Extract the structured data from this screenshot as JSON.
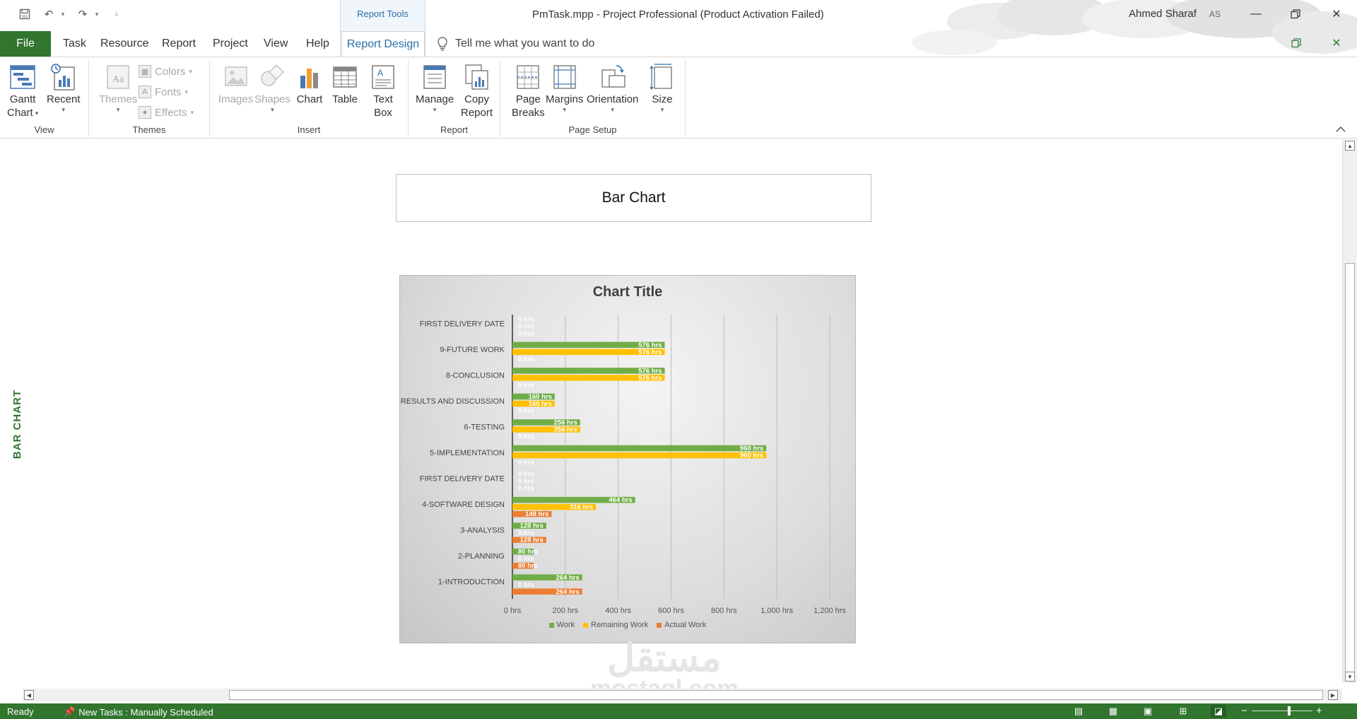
{
  "titlebar": {
    "context_tab_group": "Report Tools",
    "document_title": "PmTask.mpp  -  Project Professional (Product Activation Failed)",
    "user_name": "Ahmed Sharaf",
    "user_initials": "AS"
  },
  "tabs": {
    "file": "File",
    "task": "Task",
    "resource": "Resource",
    "report": "Report",
    "project": "Project",
    "view": "View",
    "help": "Help",
    "report_design": "Report Design",
    "tell_me": "Tell me what you want to do"
  },
  "ribbon": {
    "groups": {
      "view": "View",
      "themes": "Themes",
      "insert": "Insert",
      "report": "Report",
      "page_setup": "Page Setup"
    },
    "buttons": {
      "gantt_chart_1": "Gantt",
      "gantt_chart_2": "Chart",
      "recent": "Recent",
      "themes": "Themes",
      "colors": "Colors",
      "fonts": "Fonts",
      "effects": "Effects",
      "images": "Images",
      "shapes": "Shapes",
      "chart": "Chart",
      "table": "Table",
      "text_box_1": "Text",
      "text_box_2": "Box",
      "manage": "Manage",
      "copy_report_1": "Copy",
      "copy_report_2": "Report",
      "page_breaks_1": "Page",
      "page_breaks_2": "Breaks",
      "margins": "Margins",
      "orientation": "Orientation",
      "size": "Size"
    }
  },
  "report": {
    "side_label": "BAR CHART",
    "title": "Bar Chart"
  },
  "chart_data": {
    "type": "bar",
    "orientation": "horizontal",
    "title": "Chart Title",
    "categories": [
      "FIRST DELIVERY DATE",
      "9-FUTURE WORK",
      "8-CONCLUSION",
      "7-RESULTS AND DISCUSSION",
      "6-TESTING",
      "5-IMPLEMENTATION",
      "FIRST DELIVERY DATE",
      "4-SOFTWARE DESIGN",
      "3-ANALYSIS",
      "2-PLANNING",
      "1-INTRODUCTION"
    ],
    "series": [
      {
        "name": "Work",
        "color": "#70ad47",
        "values": [
          0,
          576,
          576,
          160,
          256,
          960,
          0,
          464,
          128,
          80,
          264
        ]
      },
      {
        "name": "Remaining Work",
        "color": "#ffc000",
        "values": [
          0,
          576,
          576,
          160,
          256,
          960,
          0,
          316,
          0,
          0,
          0
        ]
      },
      {
        "name": "Actual Work",
        "color": "#ed7d31",
        "values": [
          0,
          0,
          0,
          0,
          0,
          0,
          0,
          148,
          128,
          80,
          264
        ]
      }
    ],
    "data_labels": [
      [
        "0 hrs",
        "576 hrs",
        "576 hrs",
        "160 hrs",
        "256 hrs",
        "960 hrs",
        "0 hrs",
        "464 hrs",
        "128 hrs",
        "80 hrs",
        "264 hrs"
      ],
      [
        "0 hrs",
        "576 hrs",
        "576 hrs",
        "160 hrs",
        "256 hrs",
        "960 hrs",
        "0 hrs",
        "316 hrs",
        "0 hrs",
        "0 hrs",
        "0 hrs"
      ],
      [
        "0 hrs",
        "0 hrs",
        "0 hrs",
        "0 hrs",
        "0 hrs",
        "0 hrs",
        "0 hrs",
        "148 hrs",
        "128 hrs",
        "80 hrs",
        "264 hrs"
      ]
    ],
    "x_ticks": [
      "0 hrs",
      "200 hrs",
      "400 hrs",
      "600 hrs",
      "800 hrs",
      "1,000 hrs",
      "1,200 hrs"
    ],
    "xlim": [
      0,
      1200
    ],
    "grid": true,
    "legend_position": "bottom"
  },
  "watermark": {
    "arabic": "مستقل",
    "latin": "mostaql.com"
  },
  "statusbar": {
    "ready": "Ready",
    "new_tasks": "New Tasks : Manually Scheduled"
  }
}
